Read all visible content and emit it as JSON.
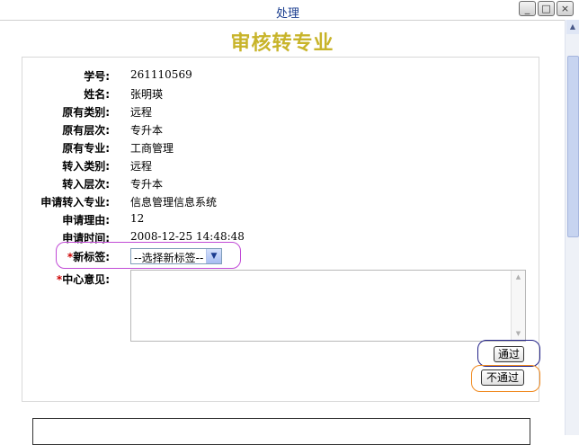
{
  "window": {
    "title": "处理",
    "buttons": [
      "_",
      "□",
      "×"
    ]
  },
  "page": {
    "heading": "审核转专业"
  },
  "form": {
    "fields": [
      {
        "label": "学号:",
        "value": "261110569"
      },
      {
        "label": "姓名:",
        "value": "张明瑛"
      },
      {
        "label": "原有类别:",
        "value": "远程"
      },
      {
        "label": "原有层次:",
        "value": "专升本"
      },
      {
        "label": "原有专业:",
        "value": "工商管理"
      },
      {
        "label": "转入类别:",
        "value": "远程"
      },
      {
        "label": "转入层次:",
        "value": "专升本"
      },
      {
        "label": "申请转入专业:",
        "value": "信息管理信息系统"
      },
      {
        "label": "申请理由:",
        "value": "12"
      },
      {
        "label": "申请时间:",
        "value": "2008-12-25 14:48:48"
      }
    ],
    "required_mark": "*",
    "new_tag": {
      "label": "新标签:",
      "selected": "--选择新标签--"
    },
    "center_opinion": {
      "label": "中心意见:",
      "value": ""
    }
  },
  "actions": {
    "pass": "通过",
    "reject": "不通过"
  },
  "colors": {
    "heading": "#c8b42a",
    "title": "#1a3d8f",
    "required": "#cc0000",
    "highlight_tag": "#c04ad6",
    "highlight_pass": "#222288",
    "highlight_reject": "#f08a20"
  }
}
